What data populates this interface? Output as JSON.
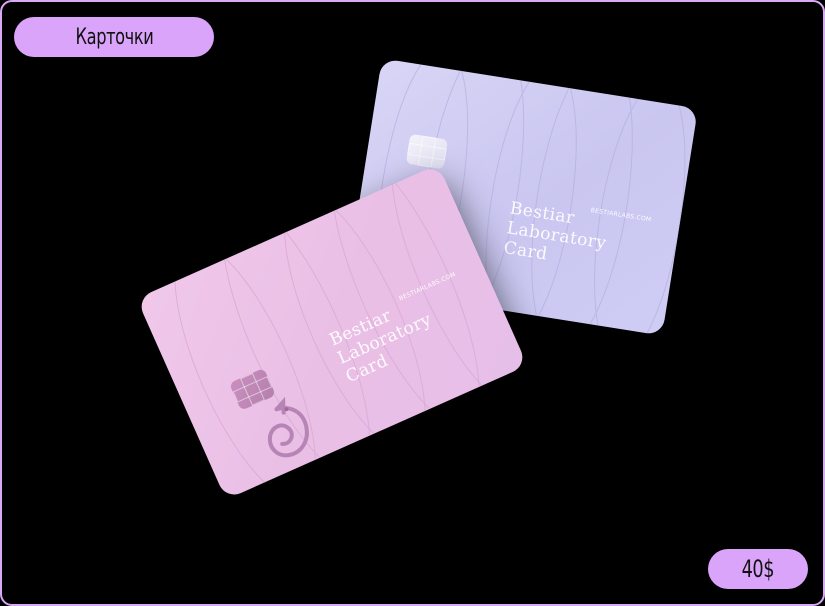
{
  "header": {
    "title": "Карточки"
  },
  "price": {
    "label": "40$"
  },
  "cards": [
    {
      "brand_line1": "Bestiar Laboratory",
      "brand_line2": "Card",
      "url": "BESTIARLABS.COM"
    },
    {
      "brand_line1": "Bestiar Laboratory",
      "brand_line2": "Card",
      "url": "BESTIARLABS.COM"
    }
  ],
  "colors": {
    "accent": "#dba4fb",
    "background": "#000000",
    "back_card": "#d1cdf3",
    "front_card": "#ecc4e9"
  },
  "icons": [
    "chip-icon",
    "dragon-logo-icon"
  ]
}
